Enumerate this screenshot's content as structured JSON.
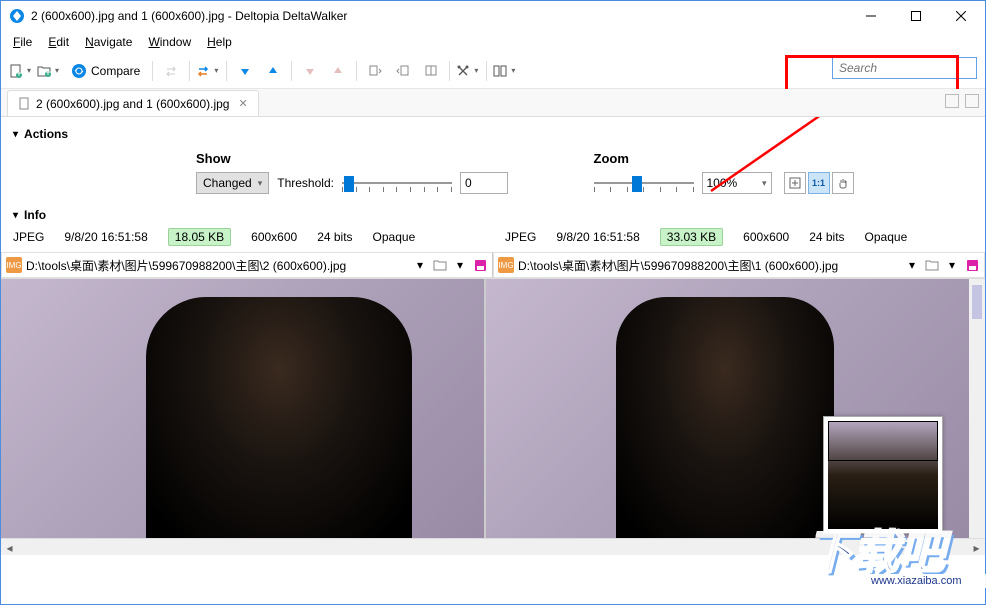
{
  "window": {
    "title": "2 (600x600).jpg and 1 (600x600).jpg - Deltopia DeltaWalker"
  },
  "menu": {
    "file": "File",
    "edit": "Edit",
    "navigate": "Navigate",
    "window": "Window",
    "help": "Help"
  },
  "toolbar": {
    "compare_label": "Compare",
    "search_placeholder": "Search"
  },
  "tab": {
    "label": "2 (600x600).jpg and 1 (600x600).jpg"
  },
  "sections": {
    "actions": "Actions",
    "info": "Info"
  },
  "show_panel": {
    "title": "Show",
    "mode": "Changed",
    "threshold_label": "Threshold:",
    "threshold_value": "0"
  },
  "zoom_panel": {
    "title": "Zoom",
    "value": "100%",
    "one_to_one": "1:1"
  },
  "info_left": {
    "format": "JPEG",
    "date": "9/8/20 16:51:58",
    "size": "18.05 KB",
    "dims": "600x600",
    "depth": "24 bits",
    "alpha": "Opaque"
  },
  "info_right": {
    "format": "JPEG",
    "date": "9/8/20 16:51:58",
    "size": "33.03 KB",
    "dims": "600x600",
    "depth": "24 bits",
    "alpha": "Opaque"
  },
  "paths": {
    "left": "D:\\tools\\桌面\\素材\\图片\\599670988200\\主图\\2 (600x600).jpg",
    "right": "D:\\tools\\桌面\\素材\\图片\\599670988200\\主图\\1 (600x600).jpg"
  },
  "watermark": {
    "text": "下载吧",
    "sub": "www.xiazaiba.com"
  }
}
